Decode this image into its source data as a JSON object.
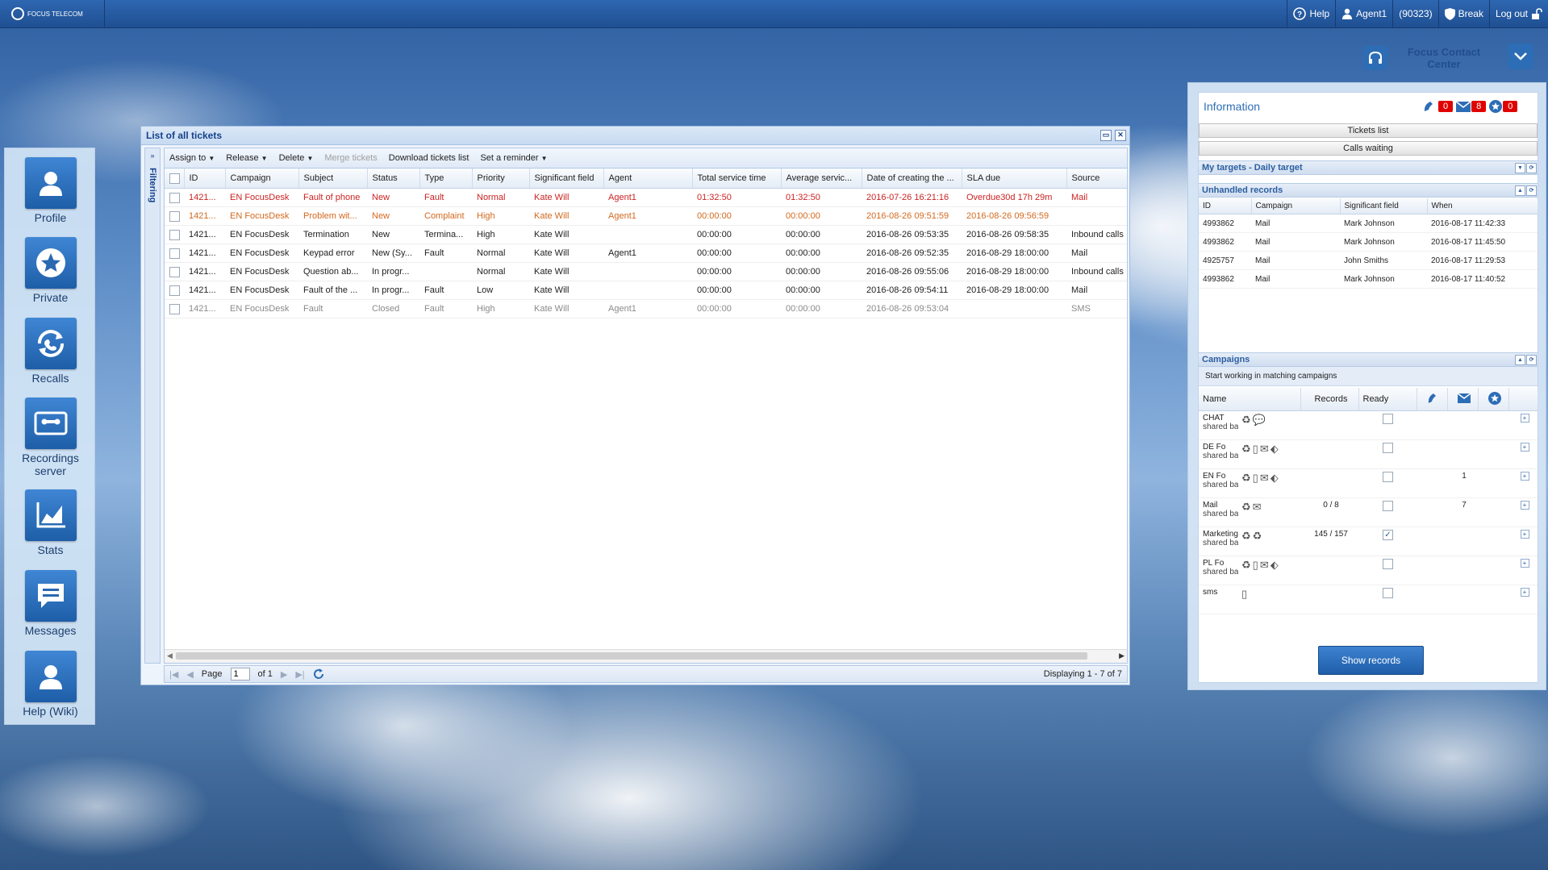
{
  "topbar": {
    "logo_text": "FOCUS TELECOM",
    "help": "Help",
    "agent": "Agent1",
    "extension": "(90323)",
    "break": "Break",
    "logout": "Log out"
  },
  "brand": {
    "line1": "Focus Contact",
    "line2": "Center"
  },
  "launcher": [
    {
      "label": "Profile",
      "icon": "person-icon"
    },
    {
      "label": "Private",
      "icon": "star-icon"
    },
    {
      "label": "Recalls",
      "icon": "recall-icon"
    },
    {
      "label": "Recordings server",
      "icon": "cassette-icon"
    },
    {
      "label": "Stats",
      "icon": "chart-icon"
    },
    {
      "label": "Messages",
      "icon": "message-icon"
    },
    {
      "label": "Help (Wiki)",
      "icon": "person-icon"
    }
  ],
  "tickets": {
    "title": "List of all tickets",
    "filtering_label": "Filtering",
    "toolbar": {
      "assign": "Assign to",
      "release": "Release",
      "delete": "Delete",
      "merge": "Merge tickets",
      "download": "Download tickets list",
      "reminder": "Set a reminder"
    },
    "columns": [
      "ID",
      "Campaign",
      "Subject",
      "Status",
      "Type",
      "Priority",
      "Significant field",
      "Agent",
      "Total service time",
      "Average servic...",
      "Date of creating the ...",
      "SLA due",
      "Source"
    ],
    "rows": [
      {
        "style": "red",
        "cells": [
          "1421...",
          "EN FocusDesk",
          "Fault of phone",
          "New",
          "Fault",
          "Normal",
          "Kate Will",
          "Agent1",
          "01:32:50",
          "01:32:50",
          "2016-07-26 16:21:16",
          "Overdue30d 17h 29m",
          "Mail"
        ]
      },
      {
        "style": "orange",
        "cells": [
          "1421...",
          "EN FocusDesk",
          "Problem wit...",
          "New",
          "Complaint",
          "High",
          "Kate Will",
          "Agent1",
          "00:00:00",
          "00:00:00",
          "2016-08-26 09:51:59",
          "2016-08-26 09:56:59",
          ""
        ]
      },
      {
        "style": "norm",
        "cells": [
          "1421...",
          "EN FocusDesk",
          "Termination",
          "New",
          "Termina...",
          "High",
          "Kate Will",
          "",
          "00:00:00",
          "00:00:00",
          "2016-08-26 09:53:35",
          "2016-08-26 09:58:35",
          "Inbound calls"
        ]
      },
      {
        "style": "norm",
        "cells": [
          "1421...",
          "EN FocusDesk",
          "Keypad error",
          "New (Sy...",
          "Fault",
          "Normal",
          "Kate Will",
          "Agent1",
          "00:00:00",
          "00:00:00",
          "2016-08-26 09:52:35",
          "2016-08-29 18:00:00",
          "Mail"
        ]
      },
      {
        "style": "norm",
        "cells": [
          "1421...",
          "EN FocusDesk",
          "Question ab...",
          "In progr...",
          "",
          "Normal",
          "Kate Will",
          "",
          "00:00:00",
          "00:00:00",
          "2016-08-26 09:55:06",
          "2016-08-29 18:00:00",
          "Inbound calls"
        ]
      },
      {
        "style": "norm",
        "cells": [
          "1421...",
          "EN FocusDesk",
          "Fault of the ...",
          "In progr...",
          "Fault",
          "Low",
          "Kate Will",
          "",
          "00:00:00",
          "00:00:00",
          "2016-08-26 09:54:11",
          "2016-08-29 18:00:00",
          "Mail"
        ]
      },
      {
        "style": "grey",
        "cells": [
          "1421...",
          "EN FocusDesk",
          "Fault",
          "Closed",
          "Fault",
          "High",
          "Kate Will",
          "Agent1",
          "00:00:00",
          "00:00:00",
          "2016-08-26 09:53:04",
          "",
          "SMS"
        ]
      }
    ],
    "pager": {
      "page_label": "Page",
      "page_value": "1",
      "of": "of 1",
      "displaying": "Displaying 1 - 7 of 7"
    }
  },
  "info": {
    "title": "Information",
    "counters": {
      "calls": "0",
      "mails": "8",
      "other": "0"
    },
    "tickets_list": "Tickets list",
    "calls_waiting": "Calls waiting",
    "targets_title": "My targets - Daily target",
    "unhandled_title": "Unhandled records",
    "unhandled_columns": [
      "ID",
      "Campaign",
      "Significant field",
      "When"
    ],
    "unhandled_rows": [
      [
        "4993862",
        "Mail",
        "Mark Johnson",
        "2016-08-17 11:42:33"
      ],
      [
        "4993862",
        "Mail",
        "Mark Johnson",
        "2016-08-17 11:45:50"
      ],
      [
        "4925757",
        "Mail",
        "John Smiths",
        "2016-08-17 11:29:53"
      ],
      [
        "4993862",
        "Mail",
        "Mark Johnson",
        "2016-08-17 11:40:52"
      ]
    ],
    "campaigns_title": "Campaigns",
    "campaigns_sub": "Start working in matching campaigns",
    "campaign_columns": {
      "name": "Name",
      "records": "Records",
      "ready": "Ready"
    },
    "campaigns": [
      {
        "name": "CHAT",
        "sub": "shared base",
        "records": "",
        "ready": false,
        "calls": "",
        "mails": ""
      },
      {
        "name": "DE Fo",
        "sub": "shared base",
        "records": "",
        "ready": false,
        "calls": "",
        "mails": ""
      },
      {
        "name": "EN Fo",
        "sub": "shared base",
        "records": "",
        "ready": false,
        "calls": "",
        "mails": "1"
      },
      {
        "name": "Mail",
        "sub": "shared base",
        "records": "0 / 8",
        "ready": false,
        "calls": "",
        "mails": "7"
      },
      {
        "name": "Marketing",
        "sub": "shared base",
        "records": "145 / 157",
        "ready": true,
        "calls": "",
        "mails": ""
      },
      {
        "name": "PL Fo",
        "sub": "shared base",
        "records": "",
        "ready": false,
        "calls": "",
        "mails": ""
      },
      {
        "name": "sms",
        "sub": "",
        "records": "",
        "ready": false,
        "calls": "",
        "mails": ""
      }
    ],
    "show_records": "Show records"
  }
}
